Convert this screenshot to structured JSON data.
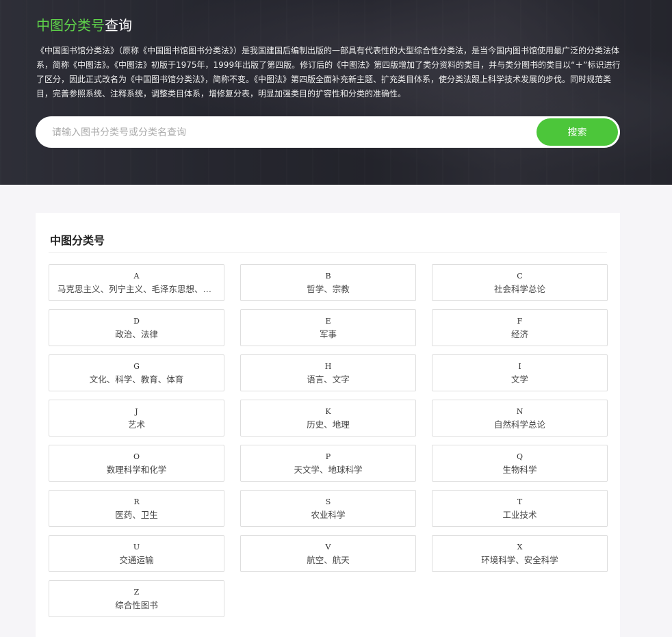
{
  "hero": {
    "title_accent": "中图分类号",
    "title_rest": "查询",
    "description": "《中国图书馆分类法》（原称《中国图书馆图书分类法》）是我国建国后编制出版的一部具有代表性的大型综合性分类法，是当今国内图书馆使用最广泛的分类法体系，简称《中图法》。《中图法》初版于1975年，1999年出版了第四版。修订后的《中图法》第四版增加了类分资料的类目，并与类分图书的类目以“＋”标识进行了区分，因此正式改名为《中国图书馆分类法》，简称不变。《中图法》第四版全面补充新主题、扩充类目体系，使分类法跟上科学技术发展的步伐。同时规范类目，完善参照系统、注释系统，调整类目体系，增修复分表，明显加强类目的扩容性和分类的准确性。"
  },
  "search": {
    "placeholder": "请输入图书分类号或分类名查询",
    "button_label": "搜索"
  },
  "panel": {
    "title": "中图分类号",
    "categories": [
      {
        "code": "A",
        "name": "马克思主义、列宁主义、毛泽东思想、邓小平理论"
      },
      {
        "code": "B",
        "name": "哲学、宗教"
      },
      {
        "code": "C",
        "name": "社会科学总论"
      },
      {
        "code": "D",
        "name": "政治、法律"
      },
      {
        "code": "E",
        "name": "军事"
      },
      {
        "code": "F",
        "name": "经济"
      },
      {
        "code": "G",
        "name": "文化、科学、教育、体育"
      },
      {
        "code": "H",
        "name": "语言、文字"
      },
      {
        "code": "I",
        "name": "文学"
      },
      {
        "code": "J",
        "name": "艺术"
      },
      {
        "code": "K",
        "name": "历史、地理"
      },
      {
        "code": "N",
        "name": "自然科学总论"
      },
      {
        "code": "O",
        "name": "数理科学和化学"
      },
      {
        "code": "P",
        "name": "天文学、地球科学"
      },
      {
        "code": "Q",
        "name": "生物科学"
      },
      {
        "code": "R",
        "name": "医药、卫生"
      },
      {
        "code": "S",
        "name": "农业科学"
      },
      {
        "code": "T",
        "name": "工业技术"
      },
      {
        "code": "U",
        "name": "交通运输"
      },
      {
        "code": "V",
        "name": "航空、航天"
      },
      {
        "code": "X",
        "name": "环境科学、安全科学"
      },
      {
        "code": "Z",
        "name": "综合性图书"
      }
    ]
  },
  "colors": {
    "accent": "#4cc63a",
    "title_accent": "#5fd24a",
    "page_background": "#f6f5f8"
  }
}
